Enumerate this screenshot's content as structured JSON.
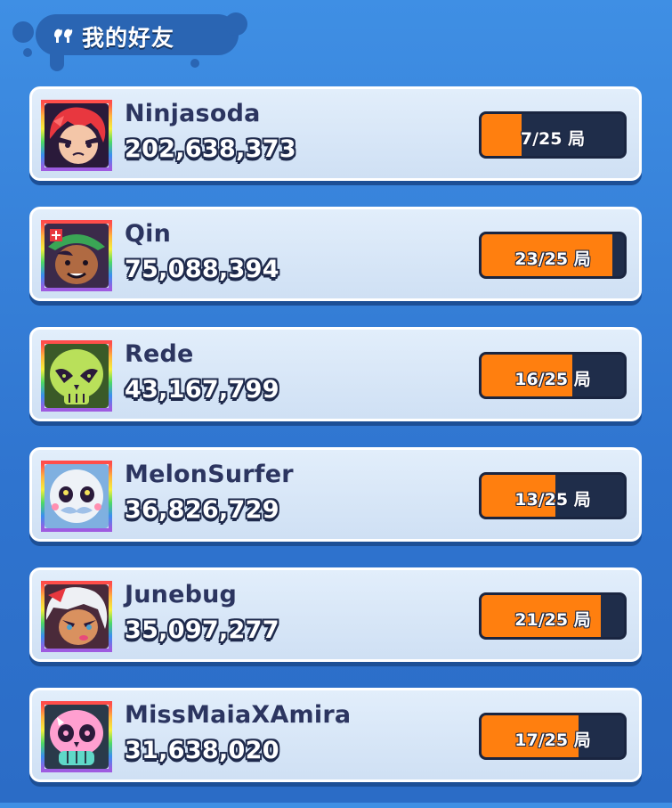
{
  "header": {
    "title": "我的好友",
    "icon": "friends-icon"
  },
  "colors": {
    "progress_fill": "#ff7f0f",
    "progress_track": "#1f2d4a"
  },
  "friends": [
    {
      "name": "Ninjasoda",
      "score": "202,638,373",
      "progress_label": "7/25 局",
      "progress": 0.28,
      "avatar": "red-haired-ninja-avatar"
    },
    {
      "name": "Qin",
      "score": "75,088,394",
      "progress_label": "23/25 局",
      "progress": 0.92,
      "avatar": "green-hat-brawler-avatar"
    },
    {
      "name": "Rede",
      "score": "43,167,799",
      "progress_label": "16/25 局",
      "progress": 0.64,
      "avatar": "green-skull-avatar"
    },
    {
      "name": "MelonSurfer",
      "score": "36,826,729",
      "progress_label": "13/25 局",
      "progress": 0.52,
      "avatar": "white-mustache-skull-avatar"
    },
    {
      "name": "Junebug",
      "score": "35,097,277",
      "progress_label": "21/25 局",
      "progress": 0.84,
      "avatar": "white-haired-girl-avatar"
    },
    {
      "name": "MissMaiaXAmira",
      "score": "31,638,020",
      "progress_label": "17/25 局",
      "progress": 0.68,
      "avatar": "pink-sugar-skull-avatar"
    }
  ]
}
